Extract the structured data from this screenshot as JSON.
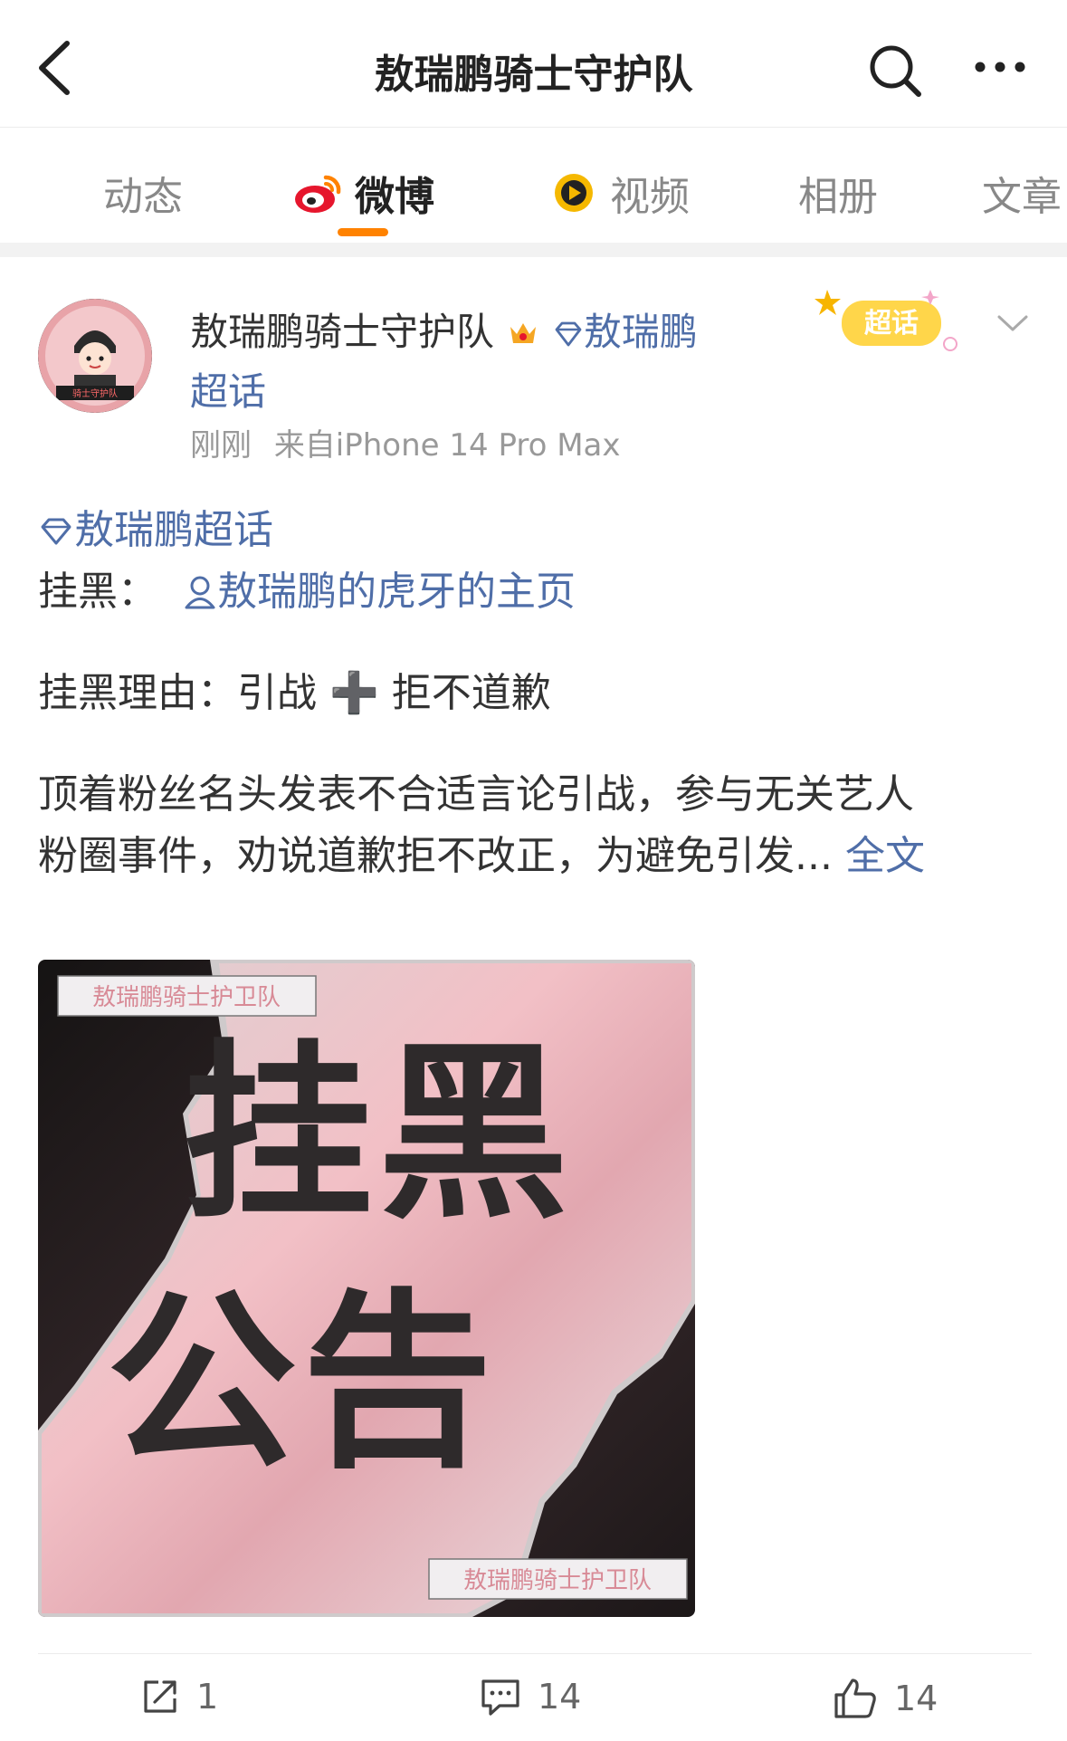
{
  "header": {
    "title": "敖瑞鹏骑士守护队"
  },
  "tabs": [
    {
      "label": "动态"
    },
    {
      "label": "微博",
      "active": true
    },
    {
      "label": "视频"
    },
    {
      "label": "相册"
    },
    {
      "label": "文章"
    }
  ],
  "post": {
    "author_name": "敖瑞鹏骑士守护队",
    "author_topic": "敖瑞鹏超话",
    "avatar_text": "骑士守护队",
    "time": "刚刚",
    "source": "来自iPhone 14 Pro Max",
    "badge_label": "超话",
    "topic_tag": "敖瑞鹏超话",
    "line2_prefix": "挂黑：",
    "line2_user": "敖瑞鹏的虎牙的主页",
    "line3": "挂黑理由：引战 ➕ 拒不道歉",
    "line4": "顶着粉丝名头发表不合适言论引战，参与无关艺人",
    "line5": "粉圈事件，劝说道歉拒不改正，为避免引发...",
    "full_text_link": "全文",
    "image": {
      "big_line1": "挂黑",
      "big_line2": "公告",
      "watermark_top": "敖瑞鹏骑士护卫队",
      "watermark_bottom": "敖瑞鹏骑士护卫队"
    }
  },
  "actions": {
    "repost_count": "1",
    "comment_count": "14",
    "like_count": "14"
  },
  "colors": {
    "accent_orange": "#ff8200",
    "link_blue": "#4f6ea8",
    "text": "#333333",
    "meta_gray": "#999999"
  }
}
